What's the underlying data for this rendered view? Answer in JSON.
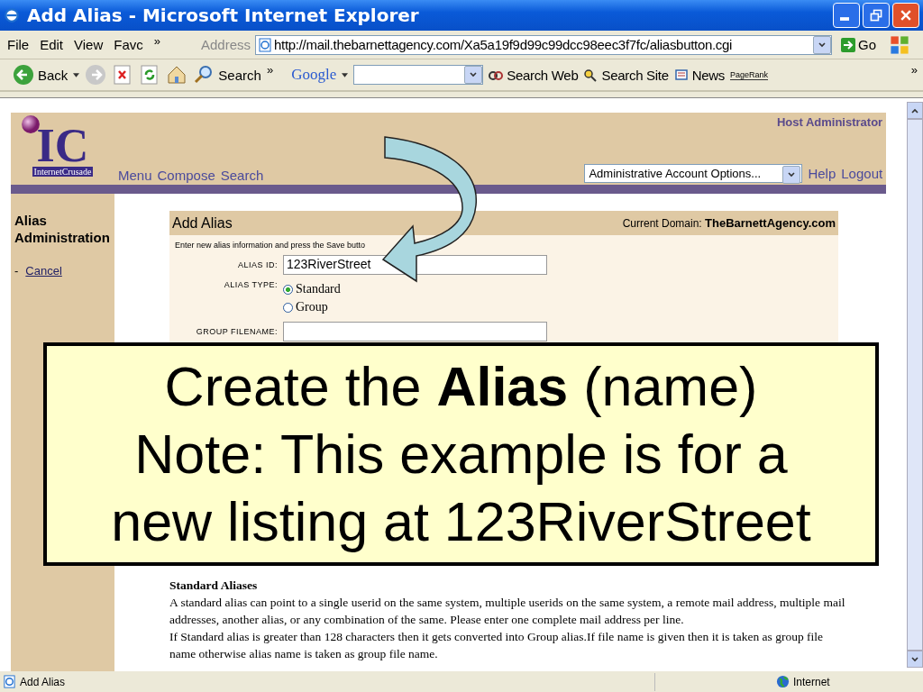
{
  "window": {
    "title": "Add Alias - Microsoft Internet Explorer"
  },
  "menu_bar": {
    "items": [
      "File",
      "Edit",
      "View",
      "Favc"
    ],
    "more": "»"
  },
  "address_bar": {
    "label": "Address",
    "url": "http://mail.thebarnettagency.com/Xa5a19f9d99c99dcc98eec3f7fc/aliasbutton.cgi",
    "go": "Go"
  },
  "toolbar": {
    "back": "Back",
    "search": "Search",
    "more": "»",
    "google_logo": "Google",
    "search_web": "Search Web",
    "search_site": "Search Site",
    "news": "News",
    "pagerank": "PageRank",
    "more_right": "»"
  },
  "page": {
    "logo": {
      "mark": "IC",
      "name": "InternetCrusade"
    },
    "user": "Host Administrator",
    "nav": [
      "Menu",
      "Compose",
      "Search"
    ],
    "account_select": "Administrative Account Options...",
    "links": [
      "Help",
      "Logout"
    ]
  },
  "sidebar": {
    "title": "Alias Administration",
    "links": [
      {
        "prefix": "-",
        "label": "Cancel"
      }
    ]
  },
  "form": {
    "title": "Add Alias",
    "domain_label": "Current Domain:",
    "domain": "TheBarnettAgency.com",
    "instructions": "Enter new alias information and press the Save butto",
    "alias_id": {
      "label": "ALIAS ID:",
      "value": "123RiverStreet"
    },
    "alias_type": {
      "label": "ALIAS TYPE:",
      "options": [
        {
          "label": "Standard",
          "selected": true
        },
        {
          "label": "Group",
          "selected": false
        }
      ]
    },
    "group_filename": {
      "label": "GROUP FILENAME:"
    }
  },
  "help": {
    "heading": "Standard Aliases",
    "paragraphs": [
      "A standard alias can point to a single userid on the same system, multiple userids on the same system, a remote mail address, multiple mail addresses, another alias, or any combination of the same. Please enter one complete mail address per line.",
      "If Standard alias is greater than 128 characters then it gets converted into Group alias.If file name is given then it is taken as group file name otherwise alias name is taken as group file name."
    ]
  },
  "callout": {
    "lines": [
      "Create the **Alias** (name)",
      "Note: This example is for a",
      "new listing at 123RiverStreet"
    ]
  },
  "status_bar": {
    "text": "Add Alias",
    "zone": "Internet"
  }
}
